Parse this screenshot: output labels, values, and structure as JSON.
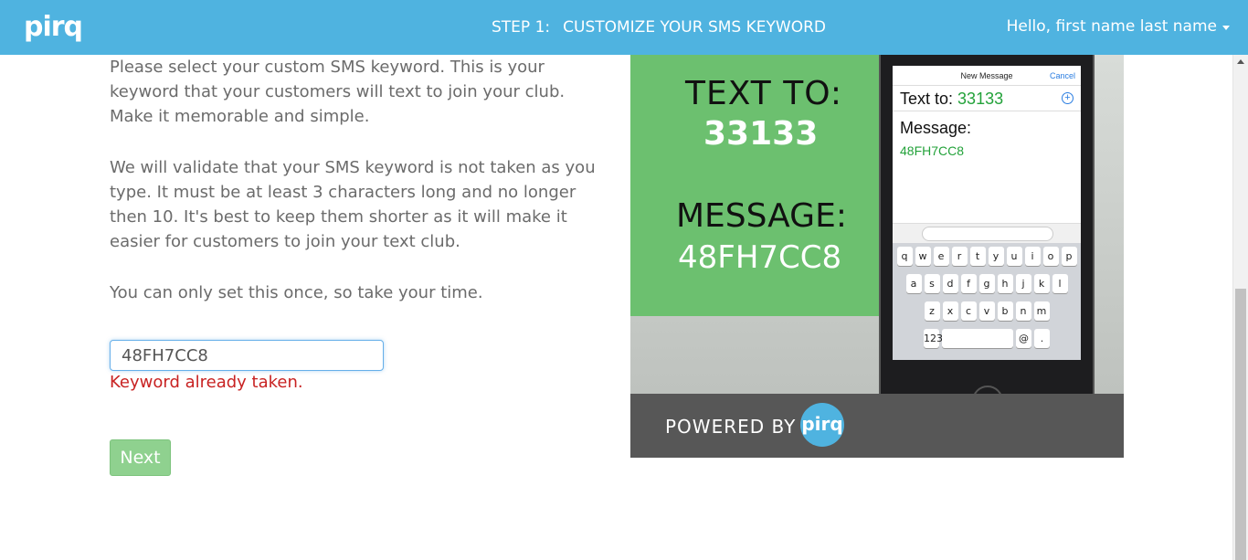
{
  "header": {
    "logo": "pirq",
    "step_label": "STEP 1:",
    "step_title": "CUSTOMIZE YOUR SMS KEYWORD",
    "user_greeting": "Hello, first name last name"
  },
  "instructions": {
    "paragraph_1": "Please select your custom SMS keyword. This is your keyword that your customers will text to join your club. Make it memorable and simple.",
    "paragraph_2": "We will validate that your SMS keyword is not taken as you type. It must be at least 3 characters long and no longer then 10. It's best to keep them shorter as it will make it easier for customers to join your text club.",
    "paragraph_3": "You can only set this once, so take your time."
  },
  "keyword_field": {
    "value": "48FH7CC8"
  },
  "error_message": "Keyword already taken.",
  "next_button": "Next",
  "promo": {
    "text_to_label": "TEXT TO:",
    "shortcode": "33133",
    "message_label": "MESSAGE:",
    "message_value": "48FH7CC8",
    "powered_by": "POWERED BY",
    "powered_logo": "pirq",
    "phone": {
      "title": "New Message",
      "cancel": "Cancel",
      "to_label": "Text to:",
      "to_number": "33133",
      "message_label": "Message:",
      "message_code": "48FH7CC8",
      "keyboard_row_1": [
        "q",
        "w",
        "e",
        "r",
        "t",
        "y",
        "u",
        "i",
        "o",
        "p"
      ],
      "keyboard_row_2": [
        "a",
        "s",
        "d",
        "f",
        "g",
        "h",
        "j",
        "k",
        "l"
      ],
      "keyboard_row_3": [
        "z",
        "x",
        "c",
        "v",
        "b",
        "n",
        "m"
      ],
      "key_123": "123",
      "key_at": "@",
      "key_dot": "."
    }
  },
  "colors": {
    "header_bg": "#4fb3e0",
    "error": "#c82222",
    "next_button": "#8fd18f",
    "promo_green": "#6cc06f"
  }
}
